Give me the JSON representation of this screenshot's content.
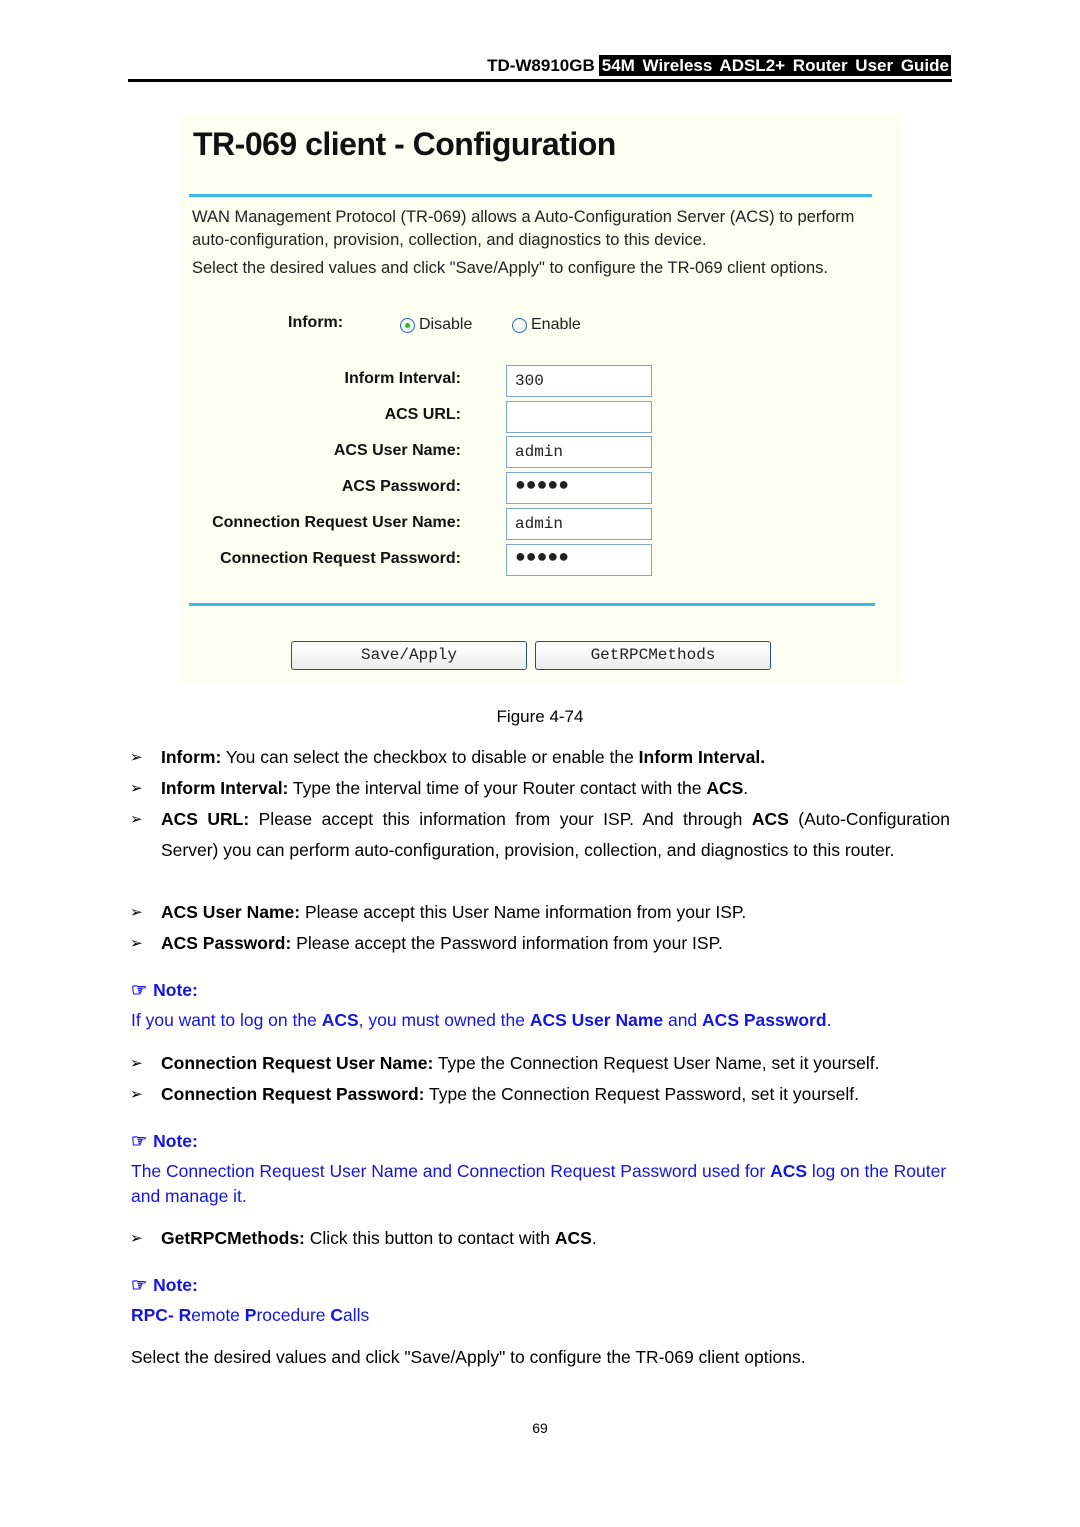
{
  "header": {
    "model": "TD-W8910GB",
    "guide_title": "54M Wireless ADSL2+ Router User Guide"
  },
  "figure": {
    "title": "TR-069 client - Configuration",
    "description_1": "WAN Management Protocol (TR-069) allows a Auto-Configuration Server (ACS) to perform auto-configuration, provision, collection, and diagnostics to this device.",
    "description_2": "Select the desired values and click \"Save/Apply\" to configure the TR-069 client options.",
    "inform": {
      "label": "Inform:",
      "options": [
        {
          "label": "Disable",
          "selected": true
        },
        {
          "label": "Enable",
          "selected": false
        }
      ]
    },
    "fields": [
      {
        "label": "Inform Interval:",
        "value": "300"
      },
      {
        "label": "ACS URL:",
        "value": ""
      },
      {
        "label": "ACS User Name:",
        "value": "admin"
      },
      {
        "label": "ACS Password:",
        "value": "●●●●●"
      },
      {
        "label": "Connection Request User Name:",
        "value": "admin"
      },
      {
        "label": "Connection Request Password:",
        "value": "●●●●●"
      }
    ],
    "buttons": {
      "save": "Save/Apply",
      "get_rpc": "GetRPCMethods"
    },
    "caption": "Figure 4-74"
  },
  "body": {
    "bullet_glyph": "➢",
    "items": [
      {
        "term": "Inform:",
        "text": " You can select the checkbox to disable or enable the ",
        "tail_bold": "Inform Interval.",
        "tail": ""
      },
      {
        "term": "Inform Interval:",
        "text": " Type the interval time of your Router contact with the ",
        "tail_bold": "ACS",
        "tail": "."
      },
      {
        "term": "ACS URL:",
        "text": " Please accept this information from your ISP. And through ",
        "tail_bold": "ACS",
        "tail": " (Auto-Configuration Server) you can perform auto-configuration, provision, collection, and diagnostics to this router."
      },
      {
        "term": "ACS User Name:",
        "text": " Please accept this User Name information from your ISP."
      },
      {
        "term": "ACS Password:",
        "text": " Please accept the Password information from your ISP."
      },
      {
        "term": "Connection Request User Name:",
        "text": " Type the Connection Request User Name, set it yourself."
      },
      {
        "term": "Connection Request Password:",
        "text": " Type the Connection Request Password, set it yourself."
      },
      {
        "term": "GetRPCMethods:",
        "text": " Click this button to contact with ",
        "tail_bold": "ACS",
        "tail": "."
      }
    ],
    "notes": [
      {
        "heading": "Note:",
        "parts": [
          {
            "t": "If you want to log on the "
          },
          {
            "b": "ACS"
          },
          {
            "t": ", you must owned the "
          },
          {
            "b": "ACS User Name"
          },
          {
            "t": " and "
          },
          {
            "b": "ACS Password"
          },
          {
            "t": "."
          }
        ]
      },
      {
        "heading": "Note:",
        "parts": [
          {
            "t": "The Connection Request User Name and Connection Request Password used for "
          },
          {
            "b": "ACS"
          },
          {
            "t": " log on the Router and manage it."
          }
        ]
      },
      {
        "heading": "Note:",
        "parts": [
          {
            "b": "RPC- R"
          },
          {
            "t": "emote "
          },
          {
            "b": "P"
          },
          {
            "t": "rocedure "
          },
          {
            "b": "C"
          },
          {
            "t": "alls"
          }
        ]
      }
    ],
    "closing": "Select the desired values and click \"Save/Apply\" to configure the TR-069 client options."
  },
  "colors": {
    "note_blue": "#1515e0",
    "panel_bg": "#fbfef0",
    "divider_blue": "#3cb9e6"
  },
  "page_number": "69"
}
